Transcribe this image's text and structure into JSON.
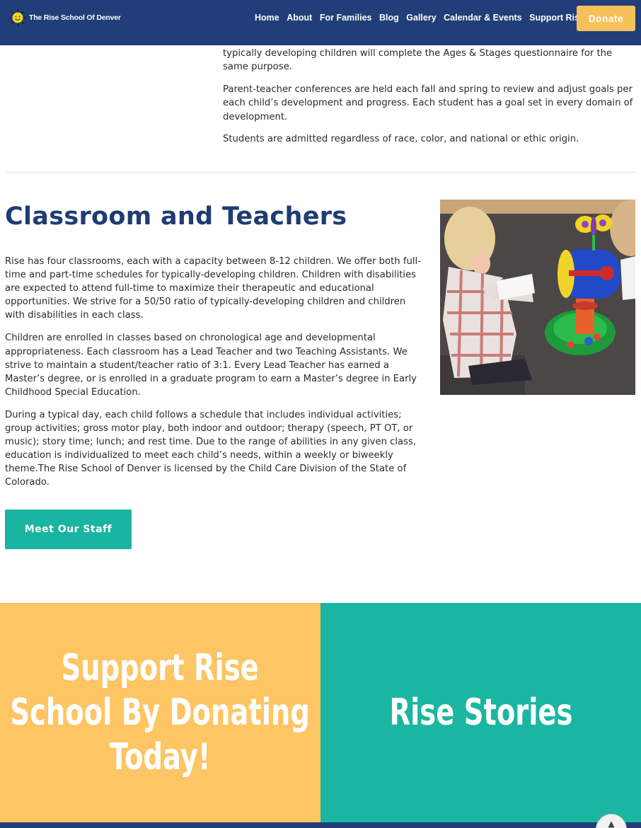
{
  "header": {
    "logo_text": "The Rise School Of Denver",
    "nav": [
      "Home",
      "About",
      "For Families",
      "Blog",
      "Gallery",
      "Calendar & Events",
      "Support Rise"
    ],
    "donate_label": "Donate"
  },
  "intro": {
    "paragraphs": [
      "typically developing children will complete the Ages & Stages questionnaire for the same purpose.",
      "Parent-teacher conferences are held each fall and spring to review and adjust goals per each child’s development and progress. Each student has a goal set in every domain of development.",
      "Students are admitted regardless of race, color, and national or ethic origin."
    ]
  },
  "classroom": {
    "title": "Classroom and Teachers",
    "paragraphs": [
      "Rise has four classrooms, each with a capacity between 8-12 children. We offer both full-time and part-time schedules for typically-developing children. Children with disabilities are expected to attend full-time to maximize their therapeutic and educational opportunities. We strive for a 50/50 ratio of typically-developing children and children with disabilities in each class.",
      "Children are enrolled in classes based on chronological age and developmental appropriateness. Each classroom has a Lead Teacher and two Teaching  Assistants. We strive to maintain a student/teacher ratio of 3:1. Every Lead Teacher has earned a Master’s degree, or is enrolled in a graduate program to earn a Master’s degree in Early Childhood Special Education.",
      "During a typical day, each child follows a schedule that includes individual activities; group activities; gross motor play, both indoor and outdoor; therapy (speech, PT OT, or music); story time; lunch; and rest time. Due to the range of abilities in any given class, education is individualized to meet each child’s needs, within a weekly or biweekly theme.The Rise School of Denver is licensed by the Child Care Division of the State of Colorado."
    ],
    "staff_button": "Meet Our Staff"
  },
  "panels": {
    "support_lines": [
      "Support Rise",
      "School By Donating",
      "Today!"
    ],
    "stories": "Rise Stories"
  },
  "colors": {
    "navy": "#213e78",
    "gold": "#fdc564",
    "teal": "#1ab6a1"
  },
  "icons": {
    "logo": "sun-icon",
    "scroll_top": "chevron-up-icon"
  }
}
